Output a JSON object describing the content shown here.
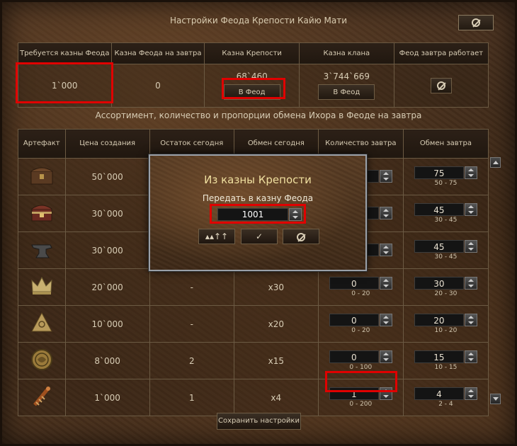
{
  "window": {
    "title": "Настройки Феода Крепости Кайю Мати"
  },
  "summary": {
    "headers": [
      "Требуется казны Феода",
      "Казна Феода на завтра",
      "Казна Крепости",
      "Казна клана",
      "Феод завтра работает"
    ],
    "required_treasury": "1`000",
    "tomorrow_treasury": "0",
    "fortress_treasury": "68`460",
    "clan_treasury": "3`744`669",
    "to_feod_label": "В Феод"
  },
  "subtitle": "Ассортимент, количество и пропорции обмена Ихора в Феоде на завтра",
  "table": {
    "headers": [
      "Артефакт",
      "Цена создания",
      "Остаток сегодня",
      "Обмен сегодня",
      "Количество завтра",
      "Обмен завтра"
    ],
    "rows": [
      {
        "icon": "chest-icon",
        "price": "50`000",
        "left_today": "",
        "exchange_today": "",
        "qty_tomorrow": "",
        "qty_range": "",
        "exch_tomorrow": "75",
        "exch_range": "50 - 75"
      },
      {
        "icon": "treasure-chest-icon",
        "price": "30`000",
        "left_today": "",
        "exchange_today": "",
        "qty_tomorrow": "",
        "qty_range": "",
        "exch_tomorrow": "45",
        "exch_range": "30 - 45"
      },
      {
        "icon": "anvil-icon",
        "price": "30`000",
        "left_today": "",
        "exchange_today": "",
        "qty_tomorrow": "",
        "qty_range": "",
        "exch_tomorrow": "45",
        "exch_range": "30 - 45"
      },
      {
        "icon": "crown-icon",
        "price": "20`000",
        "left_today": "-",
        "exchange_today": "x30",
        "qty_tomorrow": "0",
        "qty_range": "0 - 20",
        "exch_tomorrow": "30",
        "exch_range": "20 - 30"
      },
      {
        "icon": "pyramid-icon",
        "price": "10`000",
        "left_today": "-",
        "exchange_today": "x20",
        "qty_tomorrow": "0",
        "qty_range": "0 - 20",
        "exch_tomorrow": "20",
        "exch_range": "10 - 20"
      },
      {
        "icon": "medallion-icon",
        "price": "8`000",
        "left_today": "2",
        "exchange_today": "x15",
        "qty_tomorrow": "0",
        "qty_range": "0 - 100",
        "exch_tomorrow": "15",
        "exch_range": "10 - 15"
      },
      {
        "icon": "wand-icon",
        "price": "1`000",
        "left_today": "1",
        "exchange_today": "x4",
        "qty_tomorrow": "1",
        "qty_range": "0 - 200",
        "exch_tomorrow": "4",
        "exch_range": "2 - 4"
      }
    ]
  },
  "save_label": "Сохранить настройки",
  "dialog": {
    "title": "Из казны Крепости",
    "label": "Передать в казну Феода",
    "value": "1001",
    "max_label": "▴▴↑↑",
    "ok_label": "✓"
  },
  "colors": {
    "highlight": "#e00000",
    "dialog_title": "#f0e0a0"
  }
}
